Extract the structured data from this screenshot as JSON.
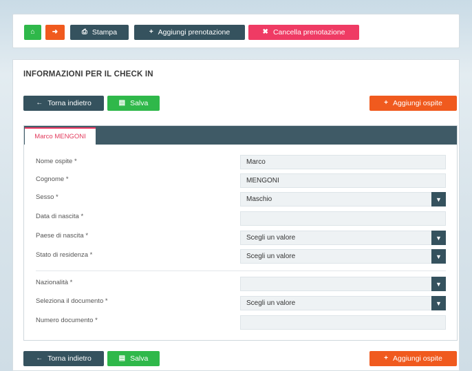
{
  "topbar": {
    "home_icon": "home-icon",
    "exit_icon": "logout-icon",
    "print_label": "Stampa",
    "add_booking_label": "Aggiungi prenotazione",
    "delete_booking_label": "Cancella prenotazione"
  },
  "section": {
    "title": "INFORMAZIONI PER IL CHECK IN"
  },
  "actions": {
    "back_label": "Torna indietro",
    "save_label": "Salva",
    "add_guest_label": "Aggiungi ospite"
  },
  "guest": {
    "tab_label": "Marco MENGONI",
    "fields": [
      {
        "label": "Nome ospite *",
        "value": "Marco"
      },
      {
        "label": "Cognome *",
        "value": "MENGONI"
      },
      {
        "label": "Sesso *",
        "value": "Maschio"
      },
      {
        "label": "Data di nascita *",
        "value": ""
      },
      {
        "label": "Paese di nascita *",
        "value": "Scegli un valore"
      },
      {
        "label": "Stato di residenza *",
        "value": "Scegli un valore"
      },
      {
        "label": "Nazionalità *",
        "value": ""
      },
      {
        "label": "Seleziona il documento *",
        "value": "Scegli un valore"
      },
      {
        "label": "Numero documento *",
        "value": ""
      }
    ]
  },
  "colors": {
    "green": "#2fb84a",
    "orange": "#f05a1e",
    "dark": "#35525e",
    "pink": "#ef3b64"
  }
}
